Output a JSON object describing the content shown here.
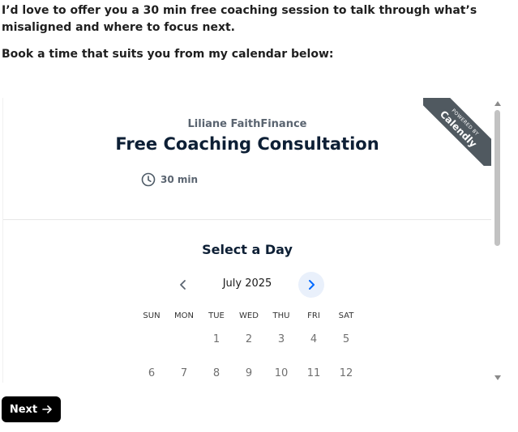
{
  "intro": {
    "line1": "I’d love to offer you a 30 min free coaching session to talk through what’s misaligned and where to focus next.",
    "line2": "Book a time that suits you from my calendar below:"
  },
  "calendly": {
    "ribbon_powered": "POWERED BY",
    "ribbon_brand": "Calendly",
    "organizer": "Liliane FaithFinance",
    "event_title": "Free Coaching Consultation",
    "duration": "30 min",
    "select_day_heading": "Select a Day",
    "month": "July 2025",
    "weekdays": [
      "SUN",
      "MON",
      "TUE",
      "WED",
      "THU",
      "FRI",
      "SAT"
    ],
    "week1": [
      "",
      "",
      "1",
      "2",
      "3",
      "4",
      "5"
    ],
    "week2": [
      "6",
      "7",
      "8",
      "9",
      "10",
      "11",
      "12"
    ]
  },
  "cta": {
    "next_label": "Next"
  },
  "colors": {
    "accent": "#0069ff",
    "nav_bg": "#e9f0fb",
    "ribbon": "#505960",
    "title": "#0d1f35"
  }
}
